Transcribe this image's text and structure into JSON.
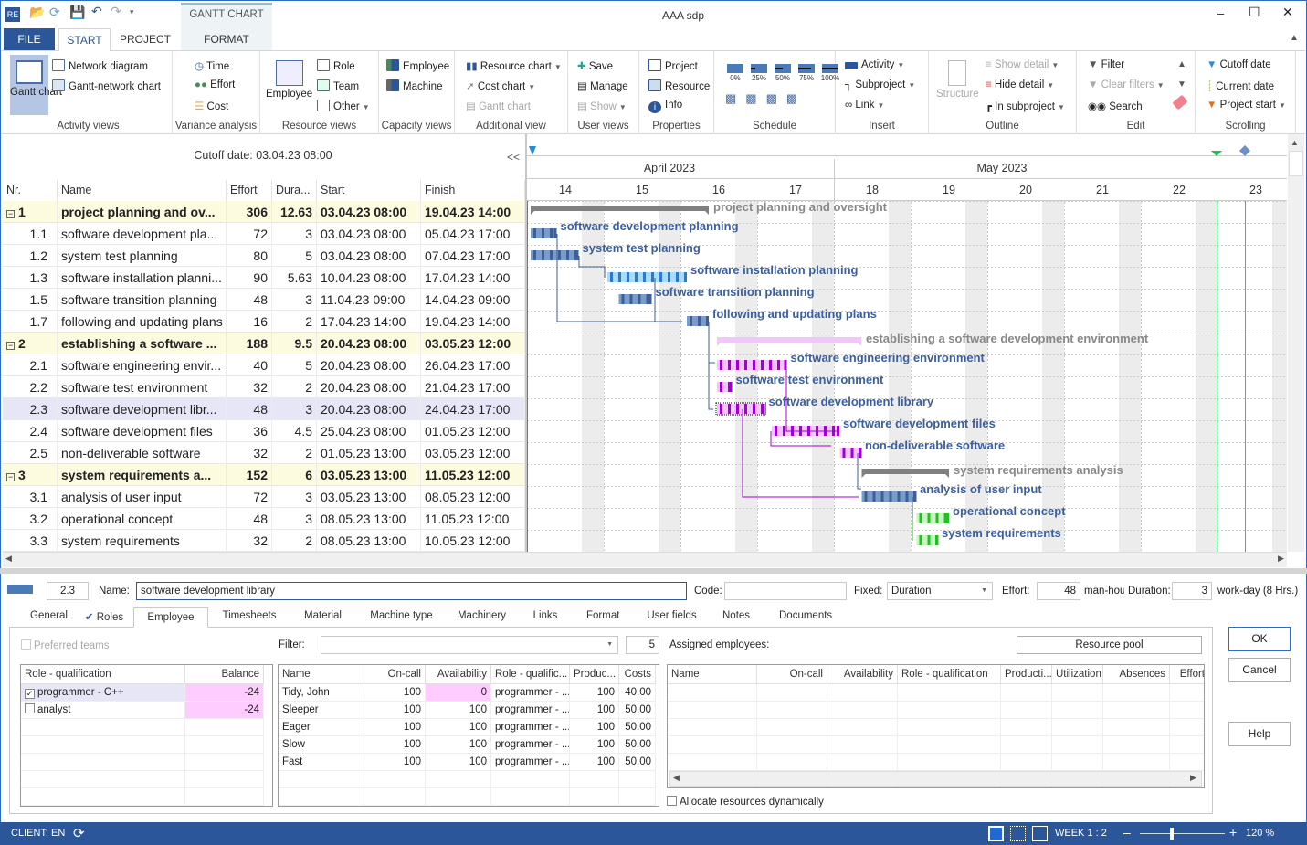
{
  "window": {
    "title": "AAA sdp",
    "context_tab": "GANTT CHART"
  },
  "tabs": [
    "FILE",
    "START",
    "PROJECT",
    "FORMAT"
  ],
  "ribbon": {
    "activity_views": {
      "label": "Activity views",
      "gantt": "Gantt chart",
      "network": "Network diagram",
      "gantt_network": "Gantt-network chart"
    },
    "variance": {
      "label": "Variance analysis",
      "time": "Time",
      "effort": "Effort",
      "cost": "Cost"
    },
    "resource_views": {
      "label": "Resource views",
      "employee": "Employee",
      "role": "Role",
      "team": "Team",
      "other": "Other"
    },
    "capacity": {
      "label": "Capacity views",
      "employee": "Employee",
      "machine": "Machine"
    },
    "additional": {
      "label": "Additional view",
      "resource_chart": "Resource chart",
      "cost_chart": "Cost chart",
      "gantt_chart": "Gantt chart"
    },
    "user_views": {
      "label": "User views",
      "save": "Save",
      "manage": "Manage",
      "show": "Show"
    },
    "properties": {
      "label": "Properties",
      "project": "Project",
      "resource": "Resource",
      "info": "Info"
    },
    "schedule": {
      "label": "Schedule",
      "percents": [
        "0%",
        "25%",
        "50%",
        "75%",
        "100%"
      ]
    },
    "insert": {
      "label": "Insert",
      "activity": "Activity",
      "subproject": "Subproject",
      "link": "Link"
    },
    "outline": {
      "label": "Outline",
      "structure": "Structure",
      "show_detail": "Show detail",
      "hide_detail": "Hide detail",
      "in_subproject": "In subproject"
    },
    "edit": {
      "label": "Edit",
      "filter": "Filter",
      "clear_filters": "Clear filters",
      "search": "Search"
    },
    "scrolling": {
      "label": "Scrolling",
      "cutoff": "Cutoff date",
      "current": "Current date",
      "project_start": "Project start"
    }
  },
  "grid": {
    "cutoff": "Cutoff date: 03.04.23 08:00",
    "collapse": "<<",
    "columns": [
      "Nr.",
      "Name",
      "Effort",
      "Dura...",
      "Start",
      "Finish"
    ],
    "tasks": [
      {
        "nr": "1",
        "name": "project planning and ov...",
        "full": "project planning and oversight",
        "effort": "306",
        "dur": "12.63",
        "start": "03.04.23 08:00",
        "finish": "19.04.23 14:00",
        "summary": true,
        "color": "#808080"
      },
      {
        "nr": "1.1",
        "name": "software development pla...",
        "full": "software development planning",
        "effort": "72",
        "dur": "3",
        "start": "03.04.23 08:00",
        "finish": "05.04.23 17:00",
        "color": "blue"
      },
      {
        "nr": "1.2",
        "name": "system test planning",
        "full": "system test planning",
        "effort": "80",
        "dur": "5",
        "start": "03.04.23 08:00",
        "finish": "07.04.23 17:00",
        "color": "blue"
      },
      {
        "nr": "1.3",
        "name": "software installation planni...",
        "full": "software installation planning",
        "effort": "90",
        "dur": "5.63",
        "start": "10.04.23 08:00",
        "finish": "17.04.23 14:00",
        "color": "lightblue"
      },
      {
        "nr": "1.5",
        "name": "software transition planning",
        "full": "software transition planning",
        "effort": "48",
        "dur": "3",
        "start": "11.04.23 09:00",
        "finish": "14.04.23 09:00",
        "color": "blue"
      },
      {
        "nr": "1.7",
        "name": "following and updating plans",
        "full": "following and updating plans",
        "effort": "16",
        "dur": "2",
        "start": "17.04.23 14:00",
        "finish": "19.04.23 14:00",
        "color": "blue"
      },
      {
        "nr": "2",
        "name": "establishing a software ...",
        "full": "establishing a software development environment",
        "effort": "188",
        "dur": "9.5",
        "start": "20.04.23 08:00",
        "finish": "03.05.23 12:00",
        "summary": true,
        "color": "#f2c6fa"
      },
      {
        "nr": "2.1",
        "name": "software engineering envir...",
        "full": "software engineering environment",
        "effort": "40",
        "dur": "5",
        "start": "20.04.23 08:00",
        "finish": "26.04.23 17:00",
        "color": "purple"
      },
      {
        "nr": "2.2",
        "name": "software test environment",
        "full": "software test environment",
        "effort": "32",
        "dur": "2",
        "start": "20.04.23 08:00",
        "finish": "21.04.23 17:00",
        "color": "purple"
      },
      {
        "nr": "2.3",
        "name": "software development libr...",
        "full": "software development library",
        "effort": "48",
        "dur": "3",
        "start": "20.04.23 08:00",
        "finish": "24.04.23 17:00",
        "color": "purple",
        "selected": true
      },
      {
        "nr": "2.4",
        "name": "software development files",
        "full": "software development files",
        "effort": "36",
        "dur": "4.5",
        "start": "25.04.23 08:00",
        "finish": "01.05.23 12:00",
        "color": "purple"
      },
      {
        "nr": "2.5",
        "name": "non-deliverable software",
        "full": "non-deliverable software",
        "effort": "32",
        "dur": "2",
        "start": "01.05.23 13:00",
        "finish": "03.05.23 12:00",
        "color": "purple"
      },
      {
        "nr": "3",
        "name": "system requirements a...",
        "full": "system requirements analysis",
        "effort": "152",
        "dur": "6",
        "start": "03.05.23 13:00",
        "finish": "11.05.23 12:00",
        "summary": true,
        "color": "#808080"
      },
      {
        "nr": "3.1",
        "name": "analysis of user input",
        "full": "analysis of user input",
        "effort": "72",
        "dur": "3",
        "start": "03.05.23 13:00",
        "finish": "08.05.23 12:00",
        "color": "blue"
      },
      {
        "nr": "3.2",
        "name": "operational concept",
        "full": "operational concept",
        "effort": "48",
        "dur": "3",
        "start": "08.05.23 13:00",
        "finish": "11.05.23 12:00",
        "color": "green"
      },
      {
        "nr": "3.3",
        "name": "system requirements",
        "full": "system requirements",
        "effort": "32",
        "dur": "2",
        "start": "08.05.23 13:00",
        "finish": "10.05.23 12:00",
        "color": "green"
      }
    ]
  },
  "timeline": {
    "months": [
      "April 2023",
      "May 2023"
    ],
    "weeks": [
      "14",
      "15",
      "16",
      "17",
      "18",
      "19",
      "20",
      "21",
      "22",
      "23"
    ]
  },
  "detail": {
    "nr": "2.3",
    "name_label": "Name:",
    "name": "software development library",
    "code_label": "Code:",
    "code": "",
    "fixed_label": "Fixed:",
    "fixed": "Duration",
    "effort_label": "Effort:",
    "effort": "48",
    "effort_unit": "man-hou",
    "duration_label": "Duration:",
    "duration": "3",
    "duration_unit": "work-day (8 Hrs.)",
    "tabs": [
      "General",
      "Roles",
      "Employee",
      "Timesheets",
      "Material",
      "Machine type",
      "Machinery",
      "Links",
      "Format",
      "User fields",
      "Notes",
      "Documents"
    ],
    "preferred_teams": "Preferred teams",
    "filter_label": "Filter:",
    "filter": "",
    "count": "5",
    "assigned_label": "Assigned employees:",
    "resource_pool": "Resource pool",
    "roles": {
      "columns": [
        "Role - qualification",
        "Balance"
      ],
      "rows": [
        {
          "role": "programmer - C++",
          "balance": "-24",
          "checked": true
        },
        {
          "role": "analyst",
          "balance": "-24",
          "checked": false
        }
      ]
    },
    "employees": {
      "columns": [
        "Name",
        "On-call",
        "Availability",
        "Role - qualific...",
        "Produc...",
        "Costs"
      ],
      "rows": [
        [
          "Tidy, John",
          "100",
          "0",
          "programmer - ...",
          "100",
          "40.00"
        ],
        [
          "Sleeper",
          "100",
          "100",
          "programmer - ...",
          "100",
          "50.00"
        ],
        [
          "Eager",
          "100",
          "100",
          "programmer - ...",
          "100",
          "50.00"
        ],
        [
          "Slow",
          "100",
          "100",
          "programmer - ...",
          "100",
          "50.00"
        ],
        [
          "Fast",
          "100",
          "100",
          "programmer - ...",
          "100",
          "50.00"
        ]
      ]
    },
    "assigned": {
      "columns": [
        "Name",
        "On-call",
        "Availability",
        "Role - qualification",
        "Producti...",
        "Utilization",
        "Absences",
        "Effort"
      ]
    },
    "allocate": "Allocate resources dynamically",
    "ok": "OK",
    "cancel": "Cancel",
    "help": "Help"
  },
  "status": {
    "client": "CLIENT: EN",
    "week": "WEEK 1 : 2",
    "zoom": "120 %"
  },
  "colors": {
    "accent": "#2b579a",
    "highlight": "#ffccff",
    "summary_bg": "#fdfbdf",
    "selected_bg": "#e6e6f7"
  }
}
